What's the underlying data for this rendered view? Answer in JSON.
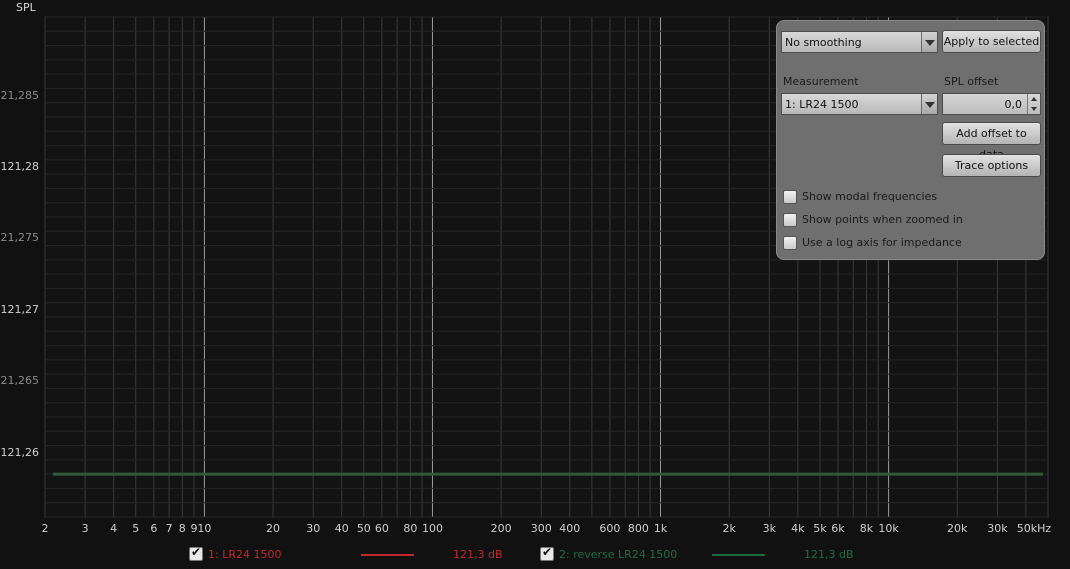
{
  "graph": {
    "y_axis_title": "SPL",
    "x_axis_ticks": [
      "2",
      "3",
      "4",
      "5",
      "6",
      "7",
      "8",
      "9",
      "10",
      "20",
      "30",
      "40",
      "50",
      "60",
      "80",
      "100",
      "200",
      "300",
      "400",
      "600",
      "800",
      "1k",
      "2k",
      "3k",
      "4k",
      "5k",
      "6k",
      "8k",
      "10k",
      "20k",
      "30k",
      "50kHz"
    ],
    "y_axis_ticks": [
      "21,285",
      "121,28",
      "21,275",
      "121,27",
      "21,265",
      "121,26"
    ],
    "trace_color": "#2e5a3a",
    "trace_value": 121.2585
  },
  "panel": {
    "smoothing_value": "No  smoothing",
    "apply_button": "Apply to selected",
    "measurement_label": "Measurement",
    "measurement_value": "1: LR24 1500",
    "spl_offset_label": "SPL offset",
    "spl_offset_value": "0,0",
    "add_offset_button": "Add offset to data",
    "trace_options_button": "Trace options",
    "checkboxes": [
      {
        "label": "Show modal frequencies",
        "checked": false
      },
      {
        "label": "Show points when zoomed in",
        "checked": false
      },
      {
        "label": "Use a log axis for impedance",
        "checked": false
      }
    ]
  },
  "legend": [
    {
      "name": "1: LR24 1500",
      "value": "121,3 dB",
      "color": "#c0282d",
      "checked": true
    },
    {
      "name": "2: reverse LR24 1500",
      "value": "121,3 dB",
      "color": "#1f6b43",
      "checked": true
    }
  ]
}
